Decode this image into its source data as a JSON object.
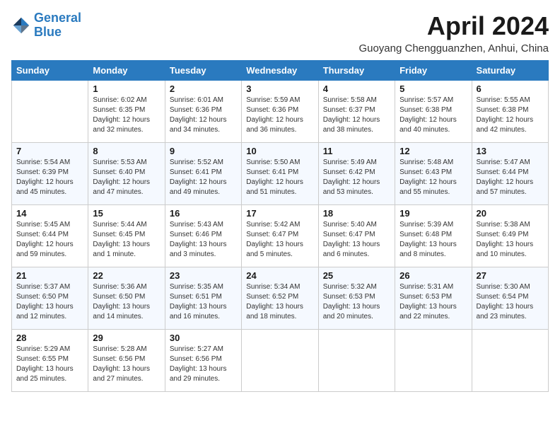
{
  "header": {
    "logo_line1": "General",
    "logo_line2": "Blue",
    "title": "April 2024",
    "subtitle": "Guoyang Chengguanzhen, Anhui, China"
  },
  "weekdays": [
    "Sunday",
    "Monday",
    "Tuesday",
    "Wednesday",
    "Thursday",
    "Friday",
    "Saturday"
  ],
  "weeks": [
    [
      {
        "day": "",
        "info": ""
      },
      {
        "day": "1",
        "info": "Sunrise: 6:02 AM\nSunset: 6:35 PM\nDaylight: 12 hours\nand 32 minutes."
      },
      {
        "day": "2",
        "info": "Sunrise: 6:01 AM\nSunset: 6:36 PM\nDaylight: 12 hours\nand 34 minutes."
      },
      {
        "day": "3",
        "info": "Sunrise: 5:59 AM\nSunset: 6:36 PM\nDaylight: 12 hours\nand 36 minutes."
      },
      {
        "day": "4",
        "info": "Sunrise: 5:58 AM\nSunset: 6:37 PM\nDaylight: 12 hours\nand 38 minutes."
      },
      {
        "day": "5",
        "info": "Sunrise: 5:57 AM\nSunset: 6:38 PM\nDaylight: 12 hours\nand 40 minutes."
      },
      {
        "day": "6",
        "info": "Sunrise: 5:55 AM\nSunset: 6:38 PM\nDaylight: 12 hours\nand 42 minutes."
      }
    ],
    [
      {
        "day": "7",
        "info": "Sunrise: 5:54 AM\nSunset: 6:39 PM\nDaylight: 12 hours\nand 45 minutes."
      },
      {
        "day": "8",
        "info": "Sunrise: 5:53 AM\nSunset: 6:40 PM\nDaylight: 12 hours\nand 47 minutes."
      },
      {
        "day": "9",
        "info": "Sunrise: 5:52 AM\nSunset: 6:41 PM\nDaylight: 12 hours\nand 49 minutes."
      },
      {
        "day": "10",
        "info": "Sunrise: 5:50 AM\nSunset: 6:41 PM\nDaylight: 12 hours\nand 51 minutes."
      },
      {
        "day": "11",
        "info": "Sunrise: 5:49 AM\nSunset: 6:42 PM\nDaylight: 12 hours\nand 53 minutes."
      },
      {
        "day": "12",
        "info": "Sunrise: 5:48 AM\nSunset: 6:43 PM\nDaylight: 12 hours\nand 55 minutes."
      },
      {
        "day": "13",
        "info": "Sunrise: 5:47 AM\nSunset: 6:44 PM\nDaylight: 12 hours\nand 57 minutes."
      }
    ],
    [
      {
        "day": "14",
        "info": "Sunrise: 5:45 AM\nSunset: 6:44 PM\nDaylight: 12 hours\nand 59 minutes."
      },
      {
        "day": "15",
        "info": "Sunrise: 5:44 AM\nSunset: 6:45 PM\nDaylight: 13 hours\nand 1 minute."
      },
      {
        "day": "16",
        "info": "Sunrise: 5:43 AM\nSunset: 6:46 PM\nDaylight: 13 hours\nand 3 minutes."
      },
      {
        "day": "17",
        "info": "Sunrise: 5:42 AM\nSunset: 6:47 PM\nDaylight: 13 hours\nand 5 minutes."
      },
      {
        "day": "18",
        "info": "Sunrise: 5:40 AM\nSunset: 6:47 PM\nDaylight: 13 hours\nand 6 minutes."
      },
      {
        "day": "19",
        "info": "Sunrise: 5:39 AM\nSunset: 6:48 PM\nDaylight: 13 hours\nand 8 minutes."
      },
      {
        "day": "20",
        "info": "Sunrise: 5:38 AM\nSunset: 6:49 PM\nDaylight: 13 hours\nand 10 minutes."
      }
    ],
    [
      {
        "day": "21",
        "info": "Sunrise: 5:37 AM\nSunset: 6:50 PM\nDaylight: 13 hours\nand 12 minutes."
      },
      {
        "day": "22",
        "info": "Sunrise: 5:36 AM\nSunset: 6:50 PM\nDaylight: 13 hours\nand 14 minutes."
      },
      {
        "day": "23",
        "info": "Sunrise: 5:35 AM\nSunset: 6:51 PM\nDaylight: 13 hours\nand 16 minutes."
      },
      {
        "day": "24",
        "info": "Sunrise: 5:34 AM\nSunset: 6:52 PM\nDaylight: 13 hours\nand 18 minutes."
      },
      {
        "day": "25",
        "info": "Sunrise: 5:32 AM\nSunset: 6:53 PM\nDaylight: 13 hours\nand 20 minutes."
      },
      {
        "day": "26",
        "info": "Sunrise: 5:31 AM\nSunset: 6:53 PM\nDaylight: 13 hours\nand 22 minutes."
      },
      {
        "day": "27",
        "info": "Sunrise: 5:30 AM\nSunset: 6:54 PM\nDaylight: 13 hours\nand 23 minutes."
      }
    ],
    [
      {
        "day": "28",
        "info": "Sunrise: 5:29 AM\nSunset: 6:55 PM\nDaylight: 13 hours\nand 25 minutes."
      },
      {
        "day": "29",
        "info": "Sunrise: 5:28 AM\nSunset: 6:56 PM\nDaylight: 13 hours\nand 27 minutes."
      },
      {
        "day": "30",
        "info": "Sunrise: 5:27 AM\nSunset: 6:56 PM\nDaylight: 13 hours\nand 29 minutes."
      },
      {
        "day": "",
        "info": ""
      },
      {
        "day": "",
        "info": ""
      },
      {
        "day": "",
        "info": ""
      },
      {
        "day": "",
        "info": ""
      }
    ]
  ]
}
